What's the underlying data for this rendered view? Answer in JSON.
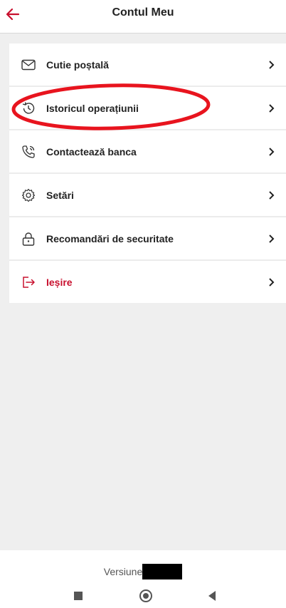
{
  "header": {
    "title": "Contul Meu",
    "back_icon": "arrow-left-icon",
    "accent_color": "#c8102e"
  },
  "menu": {
    "items": [
      {
        "label": "Cutie poștală",
        "icon": "mail-icon"
      },
      {
        "label": "Istoricul operațiunii",
        "icon": "history-icon"
      },
      {
        "label": "Contactează banca",
        "icon": "phone-icon"
      },
      {
        "label": "Setări",
        "icon": "gear-icon"
      },
      {
        "label": "Recomandări de securitate",
        "icon": "lock-icon"
      },
      {
        "label": "Ieșire",
        "icon": "logout-icon"
      }
    ],
    "chevron_icon": "chevron-right-icon",
    "highlight_color": "#e8141e"
  },
  "footer": {
    "version_label": "Versiune"
  },
  "system_nav": {
    "buttons": [
      "recents-square-icon",
      "home-circle-icon",
      "back-triangle-icon"
    ]
  }
}
